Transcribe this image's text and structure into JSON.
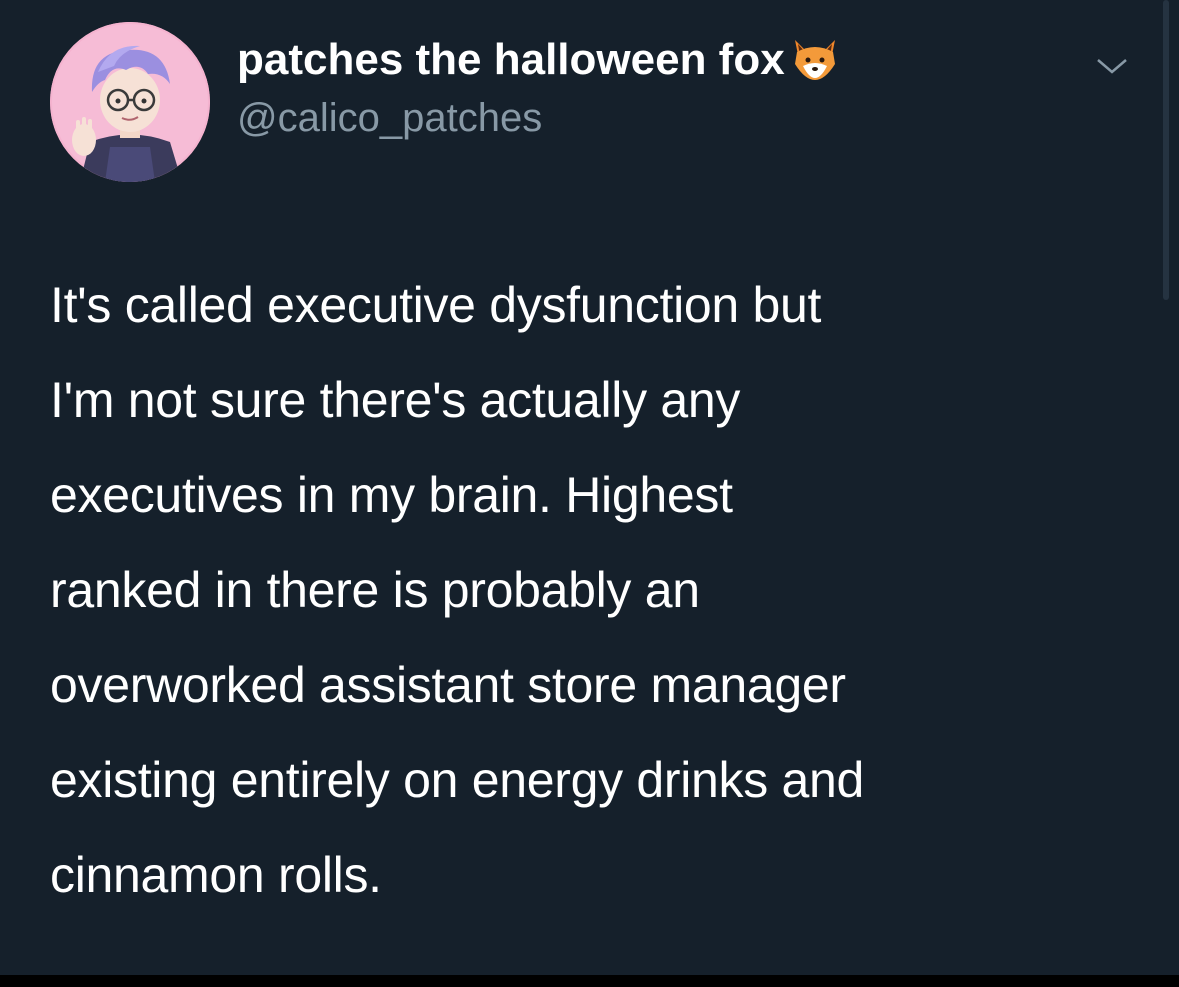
{
  "tweet": {
    "author": {
      "display_name": "patches the halloween fox",
      "name_emoji": "fox-face-emoji",
      "handle": "@calico_patches",
      "avatar": "avatar-illustration"
    },
    "menu_icon": "chevron-down-icon",
    "text": "It's called executive dysfunction but\nI'm not sure there's actually any\nexecutives in my brain. Highest\nranked in there is probably an\noverworked assistant store manager\nexisting entirely on energy drinks and\ncinnamon rolls."
  },
  "colors": {
    "background": "#15202b",
    "text_primary": "#ffffff",
    "text_secondary": "#8899a6",
    "avatar_pink": "#f2a9c9",
    "avatar_hair": "#9b8fe0"
  }
}
